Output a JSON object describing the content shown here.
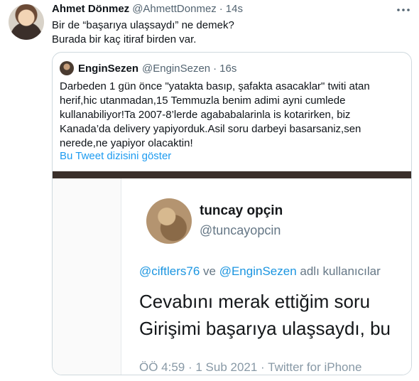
{
  "tweet": {
    "author_name": "Ahmet Dönmez",
    "handle": "@AhmettDonmez",
    "separator": "·",
    "time": "14s",
    "more_icon": "more-icon",
    "text_lines": [
      "Bir de “başarıya ulaşsaydı” ne demek?",
      "Burada bir kaç itiraf birden var."
    ]
  },
  "quote": {
    "author_name": "EnginSezen",
    "handle": "@EnginSezen",
    "separator": "·",
    "time": "16s",
    "text_lines": [
      "Darbeden 1 gün önce \"yatakta basıp, şafakta asacaklar\" twiti atan",
      "herif,hic utanmadan,15 Temmuzla benim adimi ayni cumlede",
      "kullanabiliyor!Ta 2007-8’lerde agababalarinla is kotarirken, biz",
      "Kanada’da delivery yapiyorduk.Asil soru darbeyi basarsaniz,sen",
      "nerede,ne yapiyor olacaktin!"
    ],
    "thread_link": "Bu Tweet dizisini göster"
  },
  "media": {
    "name": "tuncay opçin",
    "handle": "@tuncayopcin",
    "reply_mention_1": "@ciftlers76",
    "reply_connector": " ve ",
    "reply_mention_2": "@EnginSezen",
    "reply_suffix": " adlı kullanıcılar",
    "text_line_1": "Cevabını merak ettiğim soru",
    "text_line_2": "Girişimi başarıya ulaşsaydı, bu",
    "meta": "ÖÖ 4:59 · 1 Sub 2021 · Twitter for iPhone"
  },
  "colors": {
    "link": "#1d9bf0",
    "secondary_text": "#536471",
    "border": "#cfd9de"
  }
}
